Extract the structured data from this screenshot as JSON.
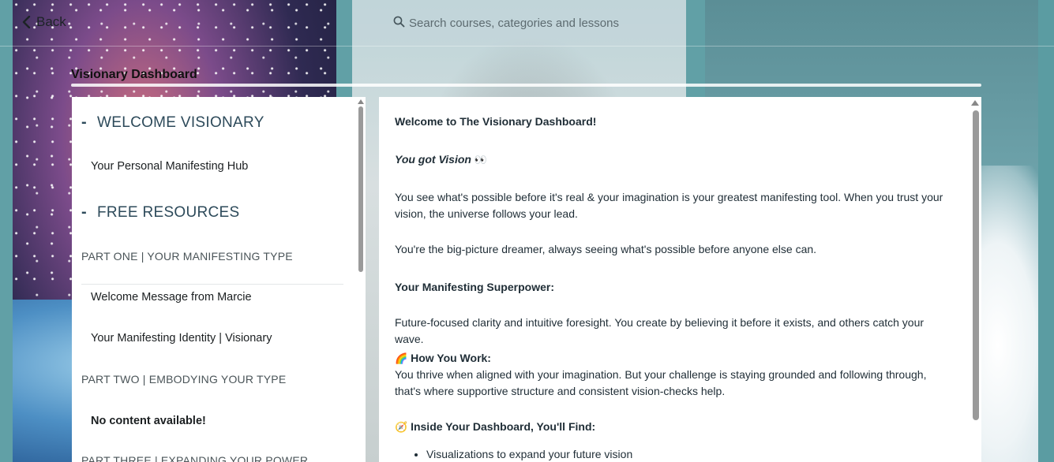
{
  "header": {
    "back_label": "Back",
    "search_placeholder": "Search courses, categories and lessons"
  },
  "page_title": "Visionary Dashboard",
  "sidebar": {
    "sections": [
      {
        "title": "WELCOME VISIONARY",
        "toggle": "-"
      },
      {
        "title": "FREE RESOURCES",
        "toggle": "-"
      }
    ],
    "welcome_items": [
      "Your Personal Manifesting Hub"
    ],
    "parts": [
      "PART ONE | YOUR MANIFESTING TYPE",
      "PART TWO | EMBODYING YOUR TYPE",
      "PART THREE | EXPANDING YOUR POWER"
    ],
    "part_one_items": [
      "Welcome Message from Marcie",
      "Your Manifesting Identity | Visionary"
    ],
    "part_two_empty": "No content available!"
  },
  "content": {
    "heading": "Welcome to The Visionary Dashboard!",
    "tagline": "You got Vision",
    "tagline_emoji": "👀",
    "p1": "You see what's possible before it's real & your imagination is your greatest manifesting tool. When you trust your vision, the universe follows your lead.",
    "p2": "You're the big-picture dreamer, always seeing what's possible before anyone else can.",
    "superpower_heading": "Your Manifesting Superpower:",
    "p3": "Future-focused clarity and intuitive foresight. You create by believing it before it exists, and others catch your wave.",
    "how_emoji": "🌈",
    "how_heading": "How You Work:",
    "p4": "You thrive when aligned with your imagination. But your challenge is staying grounded and following through, that's where supportive structure and consistent vision-checks help.",
    "inside_emoji": "🧭",
    "inside_heading": "Inside Your Dashboard, You'll Find:",
    "bullets": [
      "Visualizations to expand your future vision"
    ]
  }
}
